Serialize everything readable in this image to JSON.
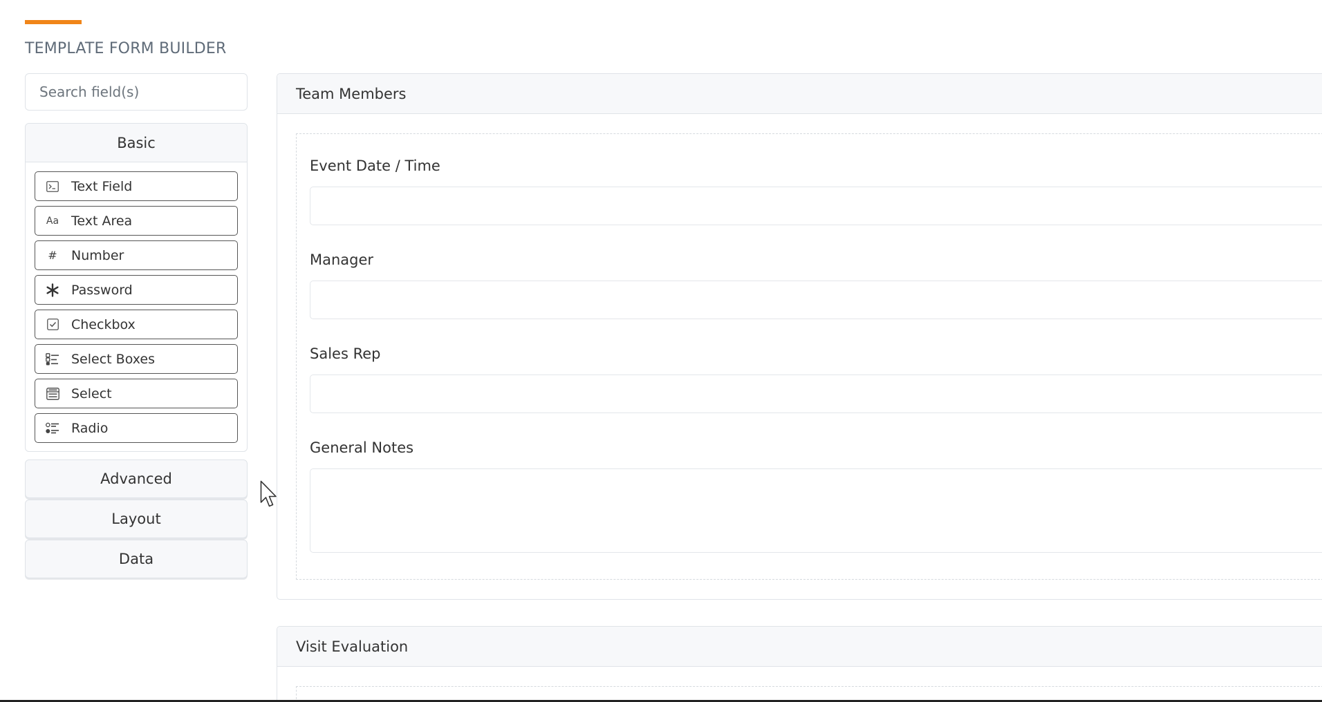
{
  "page": {
    "title": "TEMPLATE FORM BUILDER",
    "accent_color": "#f08519"
  },
  "sidebar": {
    "search": {
      "placeholder": "Search field(s)",
      "value": ""
    },
    "groups": [
      {
        "label": "Basic",
        "expanded": true,
        "components": [
          {
            "label": "Text Field",
            "icon": "terminal-icon"
          },
          {
            "label": "Text Area",
            "icon": "font-icon"
          },
          {
            "label": "Number",
            "icon": "hashtag-icon"
          },
          {
            "label": "Password",
            "icon": "asterisk-icon"
          },
          {
            "label": "Checkbox",
            "icon": "check-square-icon"
          },
          {
            "label": "Select Boxes",
            "icon": "list-checks-icon"
          },
          {
            "label": "Select",
            "icon": "select-list-icon"
          },
          {
            "label": "Radio",
            "icon": "radio-list-icon"
          }
        ]
      },
      {
        "label": "Advanced",
        "expanded": false
      },
      {
        "label": "Layout",
        "expanded": false
      },
      {
        "label": "Data",
        "expanded": false
      }
    ]
  },
  "canvas": {
    "panels": [
      {
        "title": "Team Members",
        "fields": [
          {
            "label": "Event Date / Time",
            "type": "input",
            "value": ""
          },
          {
            "label": "Manager",
            "type": "input",
            "value": ""
          },
          {
            "label": "Sales Rep",
            "type": "input",
            "value": ""
          },
          {
            "label": "General Notes",
            "type": "textarea",
            "value": ""
          }
        ]
      },
      {
        "title": "Visit Evaluation",
        "fields": []
      }
    ]
  }
}
